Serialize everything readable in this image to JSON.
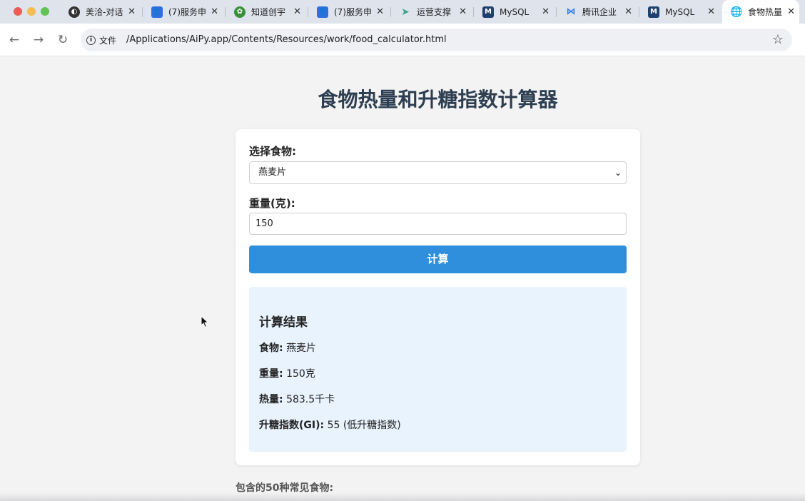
{
  "browser": {
    "tabs": [
      {
        "label": "美洽-对话",
        "icon": "meiqia-icon",
        "color": "#333333"
      },
      {
        "label": "(7)服务申",
        "icon": "user-app-icon",
        "color": "#2f6fe0"
      },
      {
        "label": "知道创宇",
        "icon": "gear-logo-icon",
        "color": "#3a8f3a"
      },
      {
        "label": "(7)服务申",
        "icon": "user-app-icon",
        "color": "#2f6fe0"
      },
      {
        "label": "运营支撑",
        "icon": "paper-plane-icon",
        "color": "#3aa58c"
      },
      {
        "label": "MySQL",
        "icon": "mysql-icon",
        "color": "#1f3f6e"
      },
      {
        "label": "腾讯企业",
        "icon": "tencent-icon",
        "color": "#2a7be4"
      },
      {
        "label": "MySQL",
        "icon": "mysql-icon",
        "color": "#1f3f6e"
      },
      {
        "label": "食物热量",
        "icon": "globe-icon",
        "color": "#444444",
        "active": true
      }
    ],
    "address": {
      "chip_label": "文件",
      "url": "/Applications/AiPy.app/Contents/Resources/work/food_calculator.html"
    }
  },
  "page": {
    "title": "食物热量和升糖指数计算器",
    "food_label": "选择食物:",
    "food_selected": "燕麦片",
    "weight_label": "重量(克):",
    "weight_value": "150",
    "calc_button": "计算",
    "result": {
      "heading": "计算结果",
      "food_key": "食物:",
      "food_val": "燕麦片",
      "weight_key": "重量:",
      "weight_val": "150克",
      "calorie_key": "热量:",
      "calorie_val": "583.5千卡",
      "gi_key": "升糖指数(GI):",
      "gi_val": "55 (低升糖指数)"
    },
    "footer_heading": "包含的50种常见食物:"
  },
  "colors": {
    "accent_button": "#2f8fdd",
    "result_bg": "#e8f3fd",
    "title_color": "#2c3e50"
  }
}
